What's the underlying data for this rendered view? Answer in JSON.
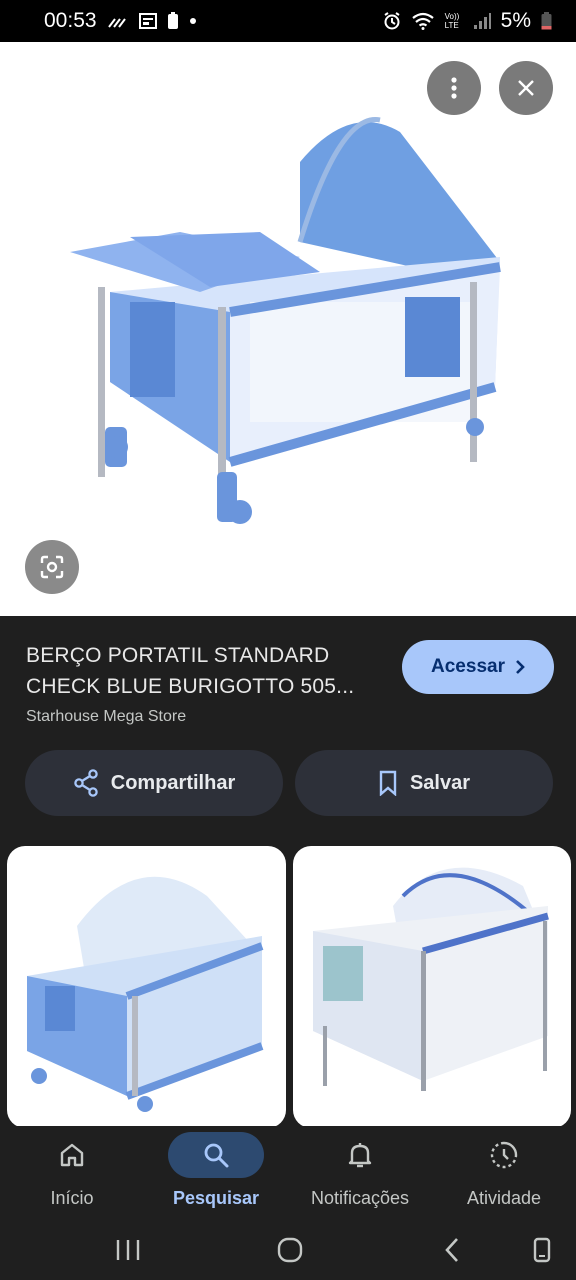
{
  "status_bar": {
    "time": "00:53",
    "battery": "5%",
    "icons": [
      "wifi-calling-icon",
      "news-icon",
      "battery-saver-icon",
      "dot-icon",
      "alarm-icon",
      "wifi-icon",
      "volte-icon",
      "signal-icon",
      "battery-icon"
    ],
    "volte_text": "Vo)) LTE"
  },
  "viewer": {
    "more_icon": "more-vert-icon",
    "close_icon": "close-icon",
    "lens_icon": "lens-icon"
  },
  "product": {
    "title": "BERÇO PORTATIL STANDARD CHECK BLUE BURIGOTTO 505...",
    "source": "Starhouse Mega Store",
    "visit_label": "Acessar"
  },
  "actions": {
    "share_label": "Compartilhar",
    "save_label": "Salvar"
  },
  "bottom_nav": {
    "items": [
      {
        "label": "Início",
        "icon": "home-icon"
      },
      {
        "label": "Pesquisar",
        "icon": "search-icon"
      },
      {
        "label": "Notificações",
        "icon": "bell-icon"
      },
      {
        "label": "Atividade",
        "icon": "activity-icon"
      }
    ],
    "active_index": 1
  },
  "colors": {
    "background": "#1f1f1f",
    "accent": "#a8c7fa",
    "active_nav_bg": "#2d4a70",
    "pill_bg": "#2d3039"
  }
}
